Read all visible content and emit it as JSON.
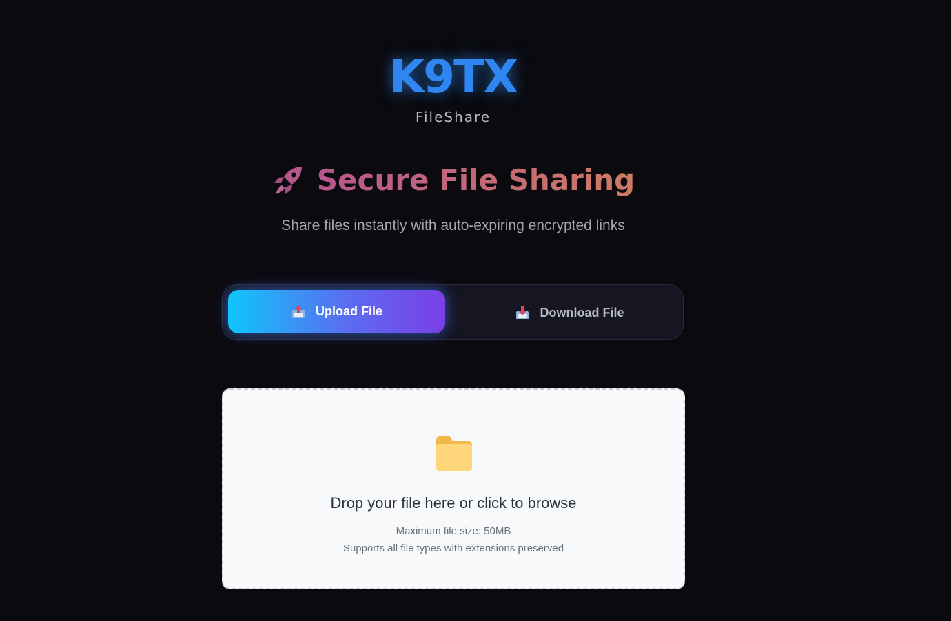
{
  "brand": {
    "logo": "K9TX",
    "subtitle": "FileShare"
  },
  "hero": {
    "icon": "rocket-icon",
    "title": "Secure File Sharing",
    "subtitle": "Share files instantly with auto-expiring encrypted links"
  },
  "tabs": [
    {
      "label": "Upload File",
      "icon": "upload-tray-icon",
      "active": true
    },
    {
      "label": "Download File",
      "icon": "download-tray-icon",
      "active": false
    }
  ],
  "dropzone": {
    "icon": "folder-icon",
    "title": "Drop your file here or click to browse",
    "max_size": "Maximum file size: 50MB",
    "supports": "Supports all file types with extensions preserved"
  },
  "colors": {
    "background": "#0b0b0f",
    "logo": "#2f86f0",
    "title_gradient_start": "#b8578f",
    "title_gradient_end": "#cf7a63",
    "tab_gradient_start": "#0fc6fb",
    "tab_gradient_end": "#7a3fe6",
    "dropzone_bg": "#f8f9fa"
  }
}
